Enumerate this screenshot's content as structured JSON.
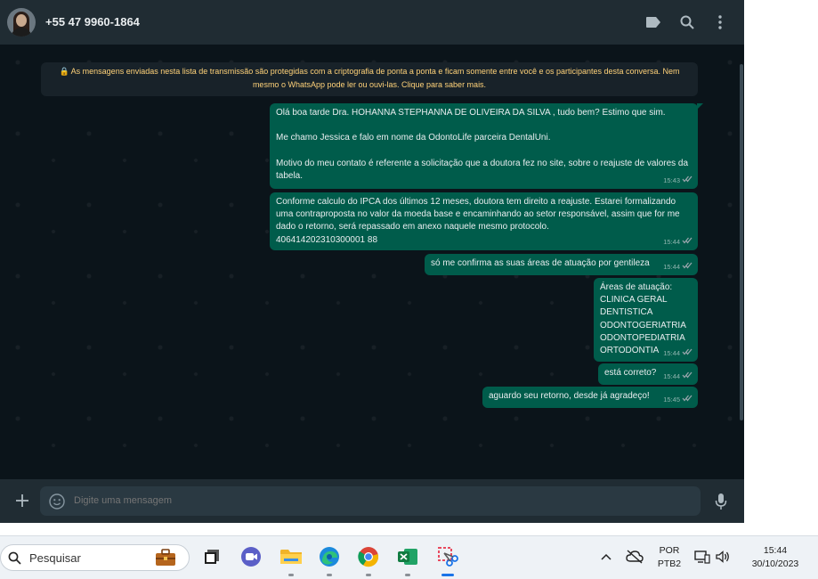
{
  "header": {
    "contact_name": "+55 47 9960-1864",
    "icons": [
      "label-icon",
      "search-icon",
      "menu-icon"
    ]
  },
  "notice": {
    "text": "🔒 As mensagens enviadas nesta lista de transmissão são protegidas com a criptografia de ponta a ponta e ficam somente entre você e os participantes desta conversa. Nem mesmo o WhatsApp pode ler ou ouvi-las. Clique para saber mais."
  },
  "messages": [
    {
      "text": "Olá boa tarde Dra. HOHANNA STEPHANNA DE OLIVEIRA DA SILVA , tudo bem? Estimo que sim.\n\nMe chamo Jessica e falo em nome da OdontoLife parceira DentalUni.\n\nMotivo do meu contato é referente a solicitação que a doutora fez no site, sobre o reajuste de valores da tabela.",
      "time": "15:43"
    },
    {
      "text": "Conforme calculo do IPCA dos últimos 12 meses, doutora tem direito a reajuste. Estarei formalizando uma contraproposta no valor da moeda base e encaminhando ao setor responsável, assim que for me dado o retorno, será repassado em anexo naquele mesmo protocolo.\n406414202310300001 88",
      "time": "15:44"
    },
    {
      "text": "só me confirma as suas áreas de atuação por gentileza",
      "time": "15:44"
    },
    {
      "text": "Áreas de atuação:\nCLINICA GERAL\nDENTISTICA\nODONTOGERIATRIA\nODONTOPEDIATRIA\nORTODONTIA",
      "time": "15:44"
    },
    {
      "text": "está correto?",
      "time": "15:44"
    },
    {
      "text": "aguardo seu retorno, desde já agradeço!",
      "time": "15:45"
    }
  ],
  "composer": {
    "placeholder": "Digite uma mensagem"
  },
  "taskbar": {
    "search_placeholder": "Pesquisar",
    "apps": [
      "briefcase-icon",
      "task-view-icon",
      "teams-icon",
      "file-explorer-icon",
      "edge-icon",
      "chrome-icon",
      "excel-icon",
      "snipping-tool-icon"
    ],
    "lang_line1": "POR",
    "lang_line2": "PTB2",
    "time": "15:44",
    "date": "30/10/2023"
  },
  "colors": {
    "chat_bg": "#0b141a",
    "header_bg": "#202c33",
    "outgoing_bubble": "#005c4b",
    "notice_text": "#ffd279"
  }
}
